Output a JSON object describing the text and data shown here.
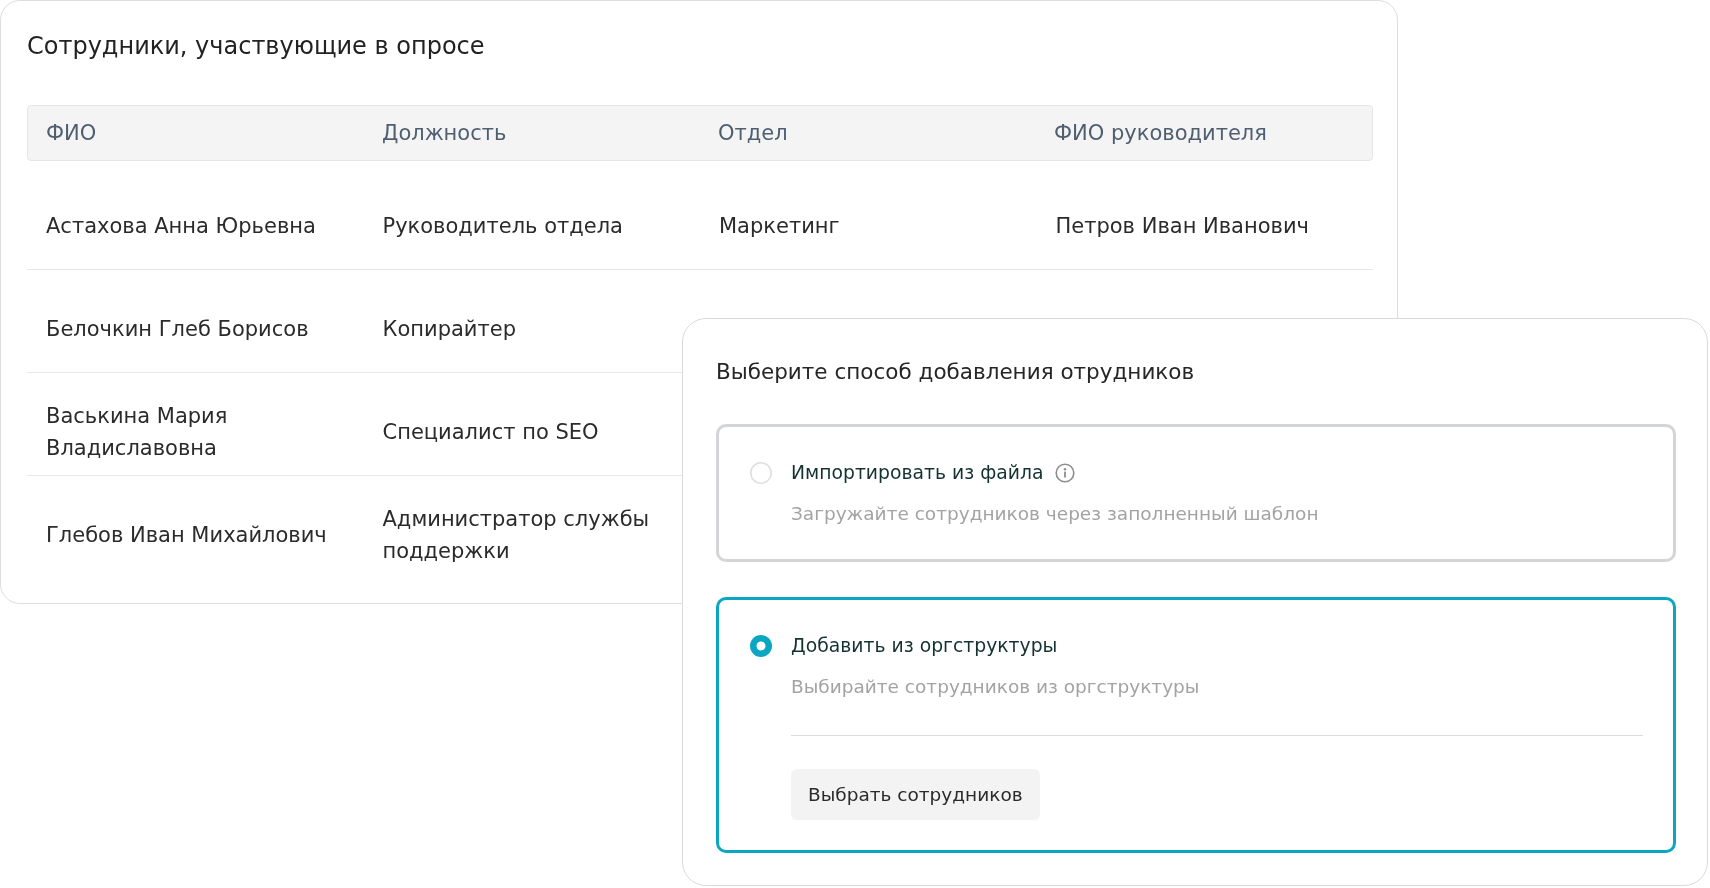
{
  "table_card": {
    "title": "Сотрудники, участвующие в опросе",
    "columns": [
      "ФИО",
      "Должность",
      "Отдел",
      "ФИО руководителя"
    ],
    "rows": [
      {
        "cells": [
          "Астахова Анна Юрьевна",
          "Руководитель отдела",
          "Маркетинг",
          "Петров Иван Иванович"
        ]
      },
      {
        "cells": [
          "Белочкин Глеб Борисов",
          "Копирайтер"
        ]
      },
      {
        "cells": [
          "Васькина Мария Владиславовна",
          "Специалист по SEO"
        ]
      },
      {
        "cells": [
          "Глебов Иван Михайлович",
          "Администратор службы поддержки"
        ]
      }
    ]
  },
  "dialog": {
    "title": "Выберите способ добавления отрудников",
    "options": [
      {
        "label": "Импортировать из файла",
        "description": "Загружайте сотрудников через заполненный шаблон",
        "selected": false,
        "info_icon": true
      },
      {
        "label": "Добавить из оргструктуры",
        "description": "Выбирайте сотрудников из оргструктуры",
        "selected": true,
        "button": "Выбрать сотрудников"
      }
    ]
  }
}
